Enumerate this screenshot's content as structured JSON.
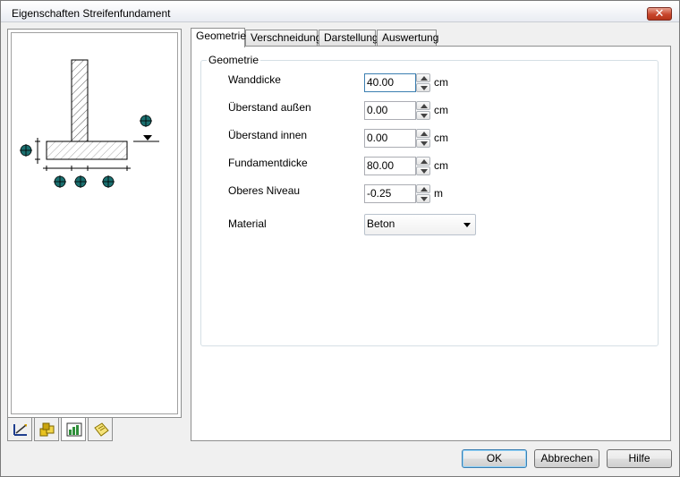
{
  "window": {
    "title": "Eigenschaften Streifenfundament",
    "close_glyph": "✕"
  },
  "tabs": [
    {
      "label": "Geometrie",
      "active": true
    },
    {
      "label": "Verschneidung",
      "active": false
    },
    {
      "label": "Darstellung",
      "active": false
    },
    {
      "label": "Auswertung",
      "active": false
    }
  ],
  "geometry_group": {
    "legend": "Geometrie",
    "fields": [
      {
        "label": "Wanddicke",
        "value": "40.00",
        "unit": "cm"
      },
      {
        "label": "Überstand außen",
        "value": "0.00",
        "unit": "cm"
      },
      {
        "label": "Überstand innen",
        "value": "0.00",
        "unit": "cm"
      },
      {
        "label": "Fundamentdicke",
        "value": "80.00",
        "unit": "cm"
      },
      {
        "label": "Oberes Niveau",
        "value": "-0.25",
        "unit": "m"
      }
    ],
    "material": {
      "label": "Material",
      "value": "Beton"
    }
  },
  "left_icon_tabs": [
    {
      "icon": "geometry-ruler-icon",
      "active": false
    },
    {
      "icon": "materials-icon",
      "active": false
    },
    {
      "icon": "chart-icon",
      "active": true
    },
    {
      "icon": "note-icon",
      "active": false
    }
  ],
  "buttons": {
    "ok": "OK",
    "cancel": "Abbrechen",
    "help": "Hilfe"
  },
  "colors": {
    "accent_blue": "#3c7fb1",
    "marker_teal": "#1a6f6f",
    "close_red": "#c8462c"
  }
}
